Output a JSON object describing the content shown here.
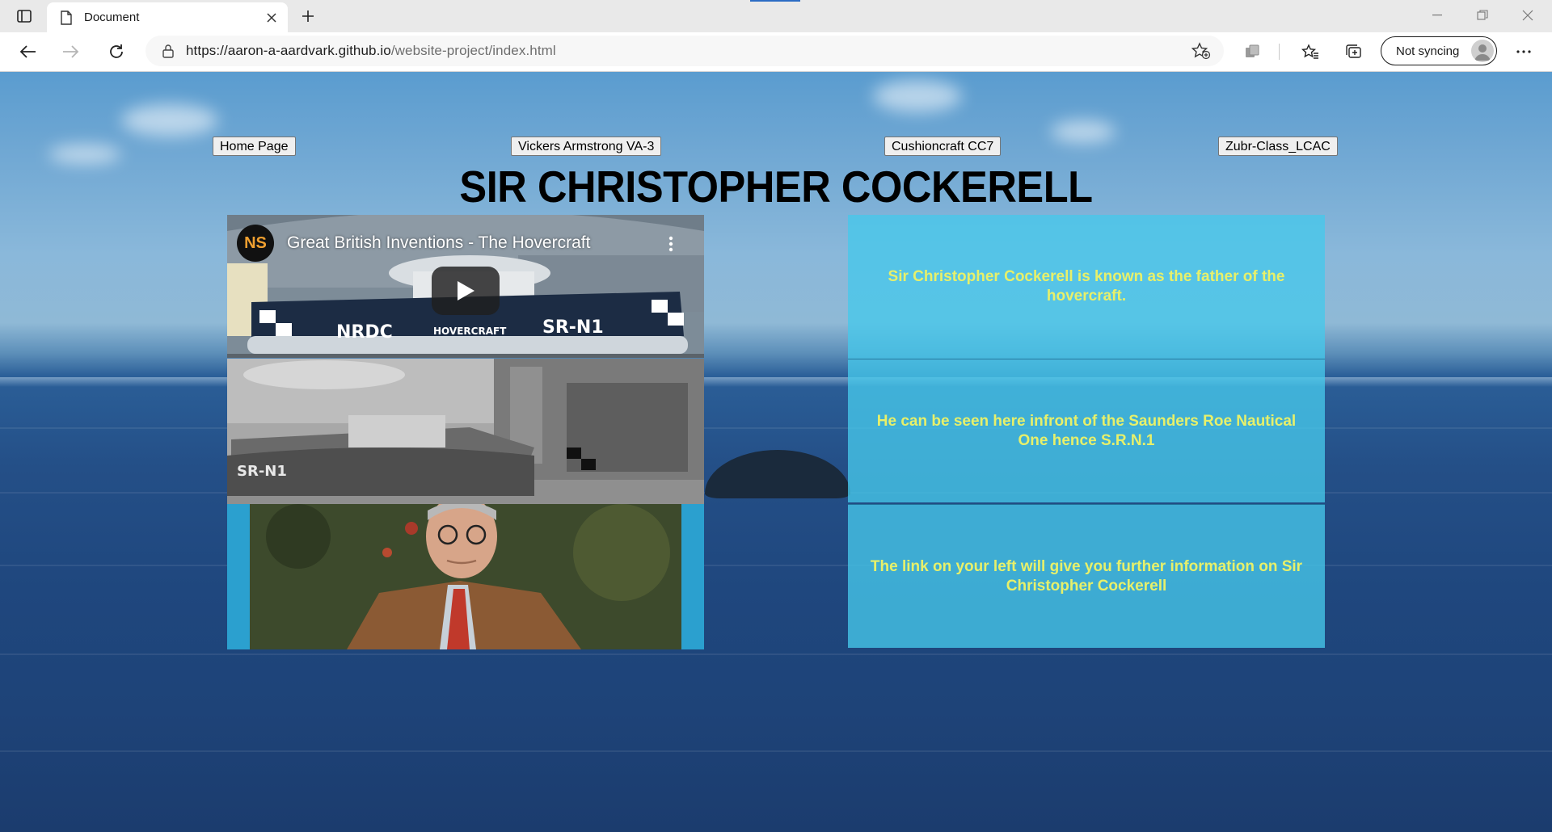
{
  "browser": {
    "tab_title": "Document",
    "url_host": "https://aaron-a-aardvark.github.io",
    "url_path": "/website-project/index.html",
    "profile_label": "Not syncing",
    "accent_color": "#2b6cc4"
  },
  "page": {
    "nav_links": [
      {
        "label": "Home Page"
      },
      {
        "label": "Vickers Armstrong VA-3"
      },
      {
        "label": "Cushioncraft CC7"
      },
      {
        "label": "Zubr-Class_LCAC"
      }
    ],
    "heading": "SIR CHRISTOPHER COCKERELL",
    "video": {
      "title": "Great British Inventions - The Hovercraft",
      "channel_initials": "NS",
      "craft_markings": [
        "NRDC",
        "HOVERCRAFT",
        "SR-N1"
      ]
    },
    "photo_marking": "SR-N1",
    "info_panels": [
      {
        "text": "Sir Christopher Cockerell is known as the father of the hovercraft."
      },
      {
        "text": "He can be seen here infront of the Saunders Roe Nautical One hence S.R.N.1"
      },
      {
        "text": "The link on your left will give you further information on Sir Christopher Cockerell"
      }
    ],
    "colors": {
      "panel_text": "#e7f06a",
      "panel_bg": "#46c8eb"
    }
  }
}
